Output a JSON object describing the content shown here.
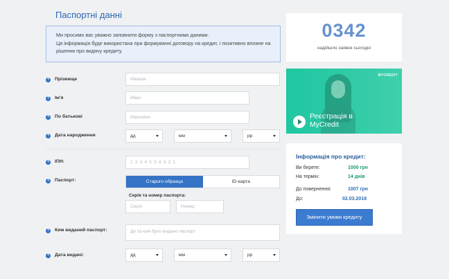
{
  "form": {
    "title": "Паспортні данні",
    "notice": [
      "Ми просимо вас уважно заповнити форму з паспортними даними.",
      "Ця інформація буде використана при формуванні договору на кредит, і позитивно вплине на рішення про видачу кредиту."
    ],
    "help_glyph": "?",
    "surname": {
      "label": "Прізвище",
      "placeholder": "Иванов"
    },
    "first_name": {
      "label": "Ім'я",
      "placeholder": "Иван"
    },
    "patronymic": {
      "label": "По батькові",
      "placeholder": "Иванович"
    },
    "birth_date": {
      "label": "Дата народження",
      "day": "дд",
      "month": "мм",
      "year": "рр"
    },
    "inn": {
      "label": "ІПН:",
      "placeholder": "1 2 3 4 5 5 4 3 2 1"
    },
    "passport": {
      "label": "Паспорт:",
      "tab_old": "Старого образца",
      "tab_id": "ID-карта",
      "series_number_label": "Серія та номер паспорта:",
      "series_placeholder": "Серія",
      "number_placeholder": "Номер"
    },
    "issued_by": {
      "label": "Ким виданий паспорт:",
      "placeholder": "Де та ким було видано паспорт"
    },
    "issue_date": {
      "label": "Дата видачі:",
      "day": "дд",
      "month": "мм",
      "year": "рр"
    }
  },
  "counter": {
    "value": "0342",
    "caption": "надійшло заявок сьогодні"
  },
  "video": {
    "brand": "MYCREDIT",
    "title_line1": "Реєстрація в",
    "title_line2": "MyCredit"
  },
  "credit": {
    "title": "Інформація про кредит:",
    "take_label": "Ви берете:",
    "take_value": "1000 грн",
    "term_label": "На термін:",
    "term_value": "14 днів",
    "return_label": "До повернення:",
    "return_value": "1007 грн",
    "until_label": "До:",
    "until_value": "02.03.2018",
    "button": "Змінити умови кредиту"
  },
  "colors": {
    "accent": "#3473c5",
    "green": "#1a9b6a",
    "counter": "#6592cf",
    "video": "#2ec9a6"
  }
}
